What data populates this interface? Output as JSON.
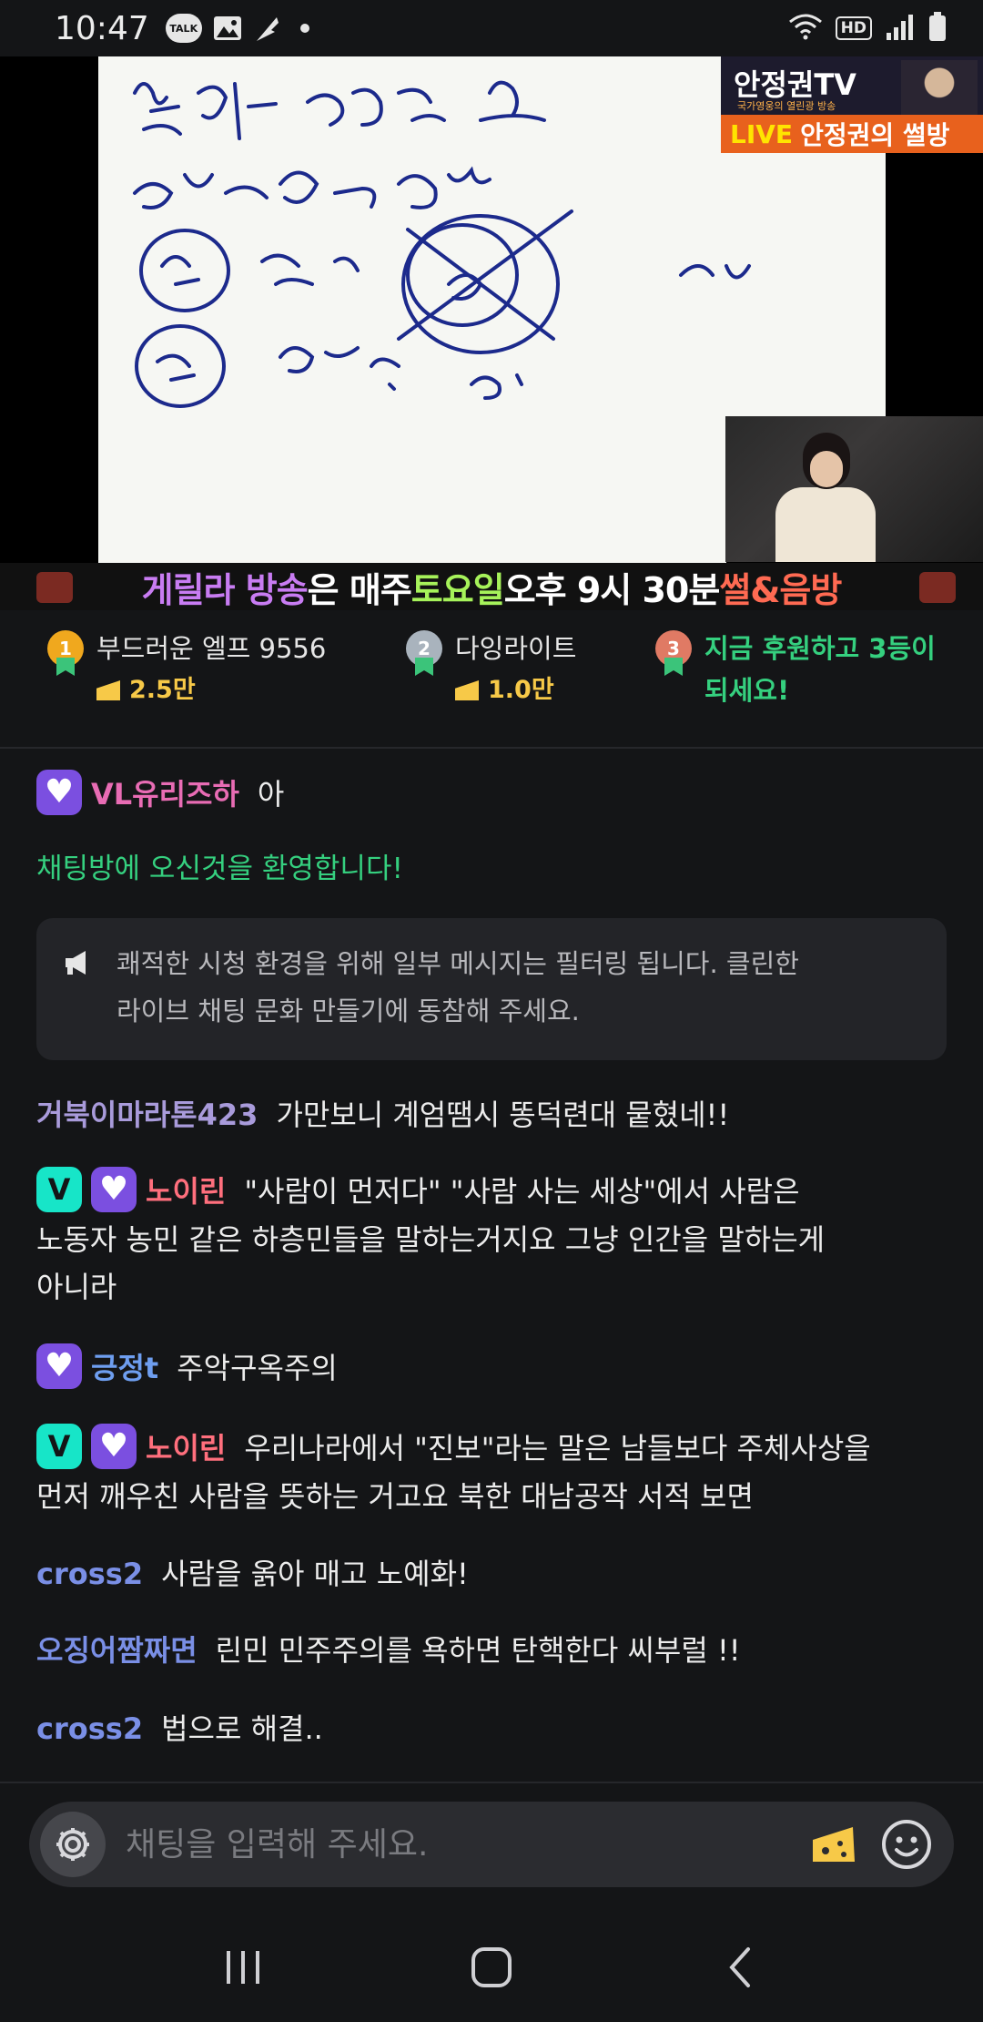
{
  "status_bar": {
    "time": "10:47",
    "talk_badge": "TALK",
    "hd_label": "HD",
    "icons": [
      "talk-icon",
      "image-icon",
      "feather-icon",
      "dot-icon",
      "wifi-icon",
      "hd-icon",
      "signal-icon",
      "battery-icon"
    ]
  },
  "video": {
    "channel_logo": "안정권TV",
    "channel_tagline": "국가영웅의 열린광 방송",
    "live_label": "LIVE",
    "live_title": "안정권의 썰방",
    "banner_parts": [
      "게릴라 방송",
      "은 매주 ",
      "토요일",
      " 오후 9시 30분 ",
      "썰&음방"
    ]
  },
  "ranking": {
    "first": {
      "rank": "1",
      "name": "부드러운 엘프 9556",
      "amount": "2.5만"
    },
    "second": {
      "rank": "2",
      "name": "다잉라이트",
      "amount": "1.0만"
    },
    "third": {
      "rank": "3",
      "cta_line1": "지금 후원하고 3등이",
      "cta_line2": "되세요!"
    }
  },
  "chat": {
    "messages": [
      {
        "nick": "VL유리즈하",
        "text": "아",
        "badges": [
          "heart"
        ],
        "nick_color": "#e86cb4"
      },
      {
        "system": "채팅방에 오신것을 환영합니다!"
      },
      {
        "notice_line1": "쾌적한 시청 환경을 위해 일부 메시지는 필터링 됩니다. 클린한",
        "notice_line2": "라이브 채팅 문화 만들기에 동참해 주세요."
      },
      {
        "nick": "거북이마라톤423",
        "text": "가만보니 계엄땜시 똥덕련대 뭍혔네!!",
        "nick_color": "#a99bdb"
      },
      {
        "nick": "노이린",
        "text_line1": "\"사람이 먼저다\" \"사람 사는 세상\"에서 사람은",
        "text_line2": "노동자 농민 같은 하층민들을 말하는거지요 그냥 인간을 말하는게",
        "text_line3": "아니라",
        "badges": [
          "v",
          "heart"
        ],
        "nick_color": "#ff6f7d"
      },
      {
        "nick": "긍정t",
        "text": "주악구옥주의",
        "badges": [
          "heart"
        ],
        "nick_color": "#6e9ef0"
      },
      {
        "nick": "노이린",
        "text_line1": "우리나라에서 \"진보\"라는 말은 남들보다 주체사상을",
        "text_line2": "먼저 깨우친 사람을 뜻하는 거고요 북한 대남공작 서적 보면",
        "badges": [
          "v",
          "heart"
        ],
        "nick_color": "#ff6f7d"
      },
      {
        "nick": "cross2",
        "text": "사람을 옭아 매고 노예화!",
        "nick_color": "#7a8fe6"
      },
      {
        "nick": "오징어짬짜면",
        "text": "린민 민주주의를 욕하면 탄핵한다 씨부럴 !!",
        "nick_color": "#7a8fe6"
      },
      {
        "nick": "cross2",
        "text": "법으로 해결..",
        "nick_color": "#7a8fe6"
      }
    ]
  },
  "input": {
    "placeholder": "채팅을 입력해 주세요."
  },
  "colors": {
    "background": "#141517",
    "accent_green": "#35d07f",
    "cheese_yellow": "#f7c948",
    "heart_badge": "#7b4fe0",
    "v_badge": "#17e5c8"
  }
}
